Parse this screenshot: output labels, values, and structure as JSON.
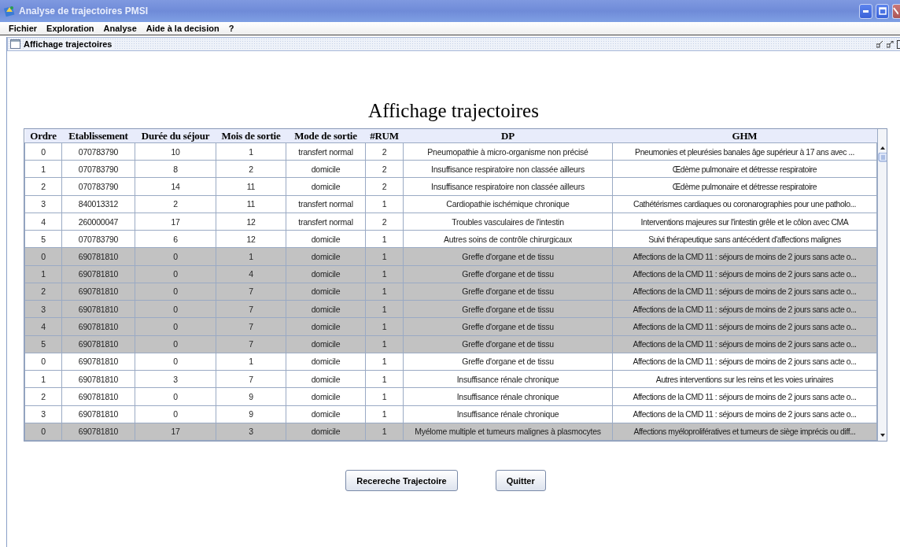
{
  "window": {
    "title": "Analyse de trajectoires PMSI"
  },
  "menu": [
    "Fichier",
    "Exploration",
    "Analyse",
    "Aide à la decision",
    "?"
  ],
  "internal_frame": {
    "title": "Affichage trajectoires"
  },
  "heading": "Affichage trajectoires",
  "table": {
    "columns": [
      "Ordre",
      "Etablissement",
      "Durée du séjour",
      "Mois de sortie",
      "Mode de sortie",
      "#RUM",
      "DP",
      "GHM"
    ],
    "rows": [
      {
        "shaded": false,
        "cells": [
          "0",
          "070783790",
          "10",
          "1",
          "transfert normal",
          "2",
          "Pneumopathie à micro-organisme non précisé",
          "Pneumonies et pleurésies banales  âge supérieur à 17 ans avec ..."
        ]
      },
      {
        "shaded": false,
        "cells": [
          "1",
          "070783790",
          "8",
          "2",
          "domicile",
          "2",
          "Insuffisance respiratoire  non classée ailleurs",
          "Œdème pulmonaire et détresse respiratoire"
        ]
      },
      {
        "shaded": false,
        "cells": [
          "2",
          "070783790",
          "14",
          "11",
          "domicile",
          "2",
          "Insuffisance respiratoire  non classée ailleurs",
          "Œdème pulmonaire et détresse respiratoire"
        ]
      },
      {
        "shaded": false,
        "cells": [
          "3",
          "840013312",
          "2",
          "11",
          "transfert normal",
          "1",
          "Cardiopathie ischémique chronique",
          "Cathétérismes cardiaques ou coronarographies pour une patholo..."
        ]
      },
      {
        "shaded": false,
        "cells": [
          "4",
          "260000047",
          "17",
          "12",
          "transfert normal",
          "2",
          "Troubles vasculaires de l'intestin",
          "Interventions majeures sur l'intestin grêle et le côlon avec CMA"
        ]
      },
      {
        "shaded": false,
        "cells": [
          "5",
          "070783790",
          "6",
          "12",
          "domicile",
          "1",
          "Autres soins de contrôle chirurgicaux",
          "Suivi thérapeutique sans antécédent d'affections malignes"
        ]
      },
      {
        "shaded": true,
        "cells": [
          "0",
          "690781810",
          "0",
          "1",
          "domicile",
          "1",
          "Greffe d'organe et de tissu",
          "Affections de la CMD 11 : séjours de moins de 2 jours  sans acte o..."
        ]
      },
      {
        "shaded": true,
        "cells": [
          "1",
          "690781810",
          "0",
          "4",
          "domicile",
          "1",
          "Greffe d'organe et de tissu",
          "Affections de la CMD 11 : séjours de moins de 2 jours  sans acte o..."
        ]
      },
      {
        "shaded": true,
        "cells": [
          "2",
          "690781810",
          "0",
          "7",
          "domicile",
          "1",
          "Greffe d'organe et de tissu",
          "Affections de la CMD 11 : séjours de moins de 2 jours  sans acte o..."
        ]
      },
      {
        "shaded": true,
        "cells": [
          "3",
          "690781810",
          "0",
          "7",
          "domicile",
          "1",
          "Greffe d'organe et de tissu",
          "Affections de la CMD 11 : séjours de moins de 2 jours  sans acte o..."
        ]
      },
      {
        "shaded": true,
        "cells": [
          "4",
          "690781810",
          "0",
          "7",
          "domicile",
          "1",
          "Greffe d'organe et de tissu",
          "Affections de la CMD 11 : séjours de moins de 2 jours  sans acte o..."
        ]
      },
      {
        "shaded": true,
        "cells": [
          "5",
          "690781810",
          "0",
          "7",
          "domicile",
          "1",
          "Greffe d'organe et de tissu",
          "Affections de la CMD 11 : séjours de moins de 2 jours  sans acte o..."
        ]
      },
      {
        "shaded": false,
        "cells": [
          "0",
          "690781810",
          "0",
          "1",
          "domicile",
          "1",
          "Greffe d'organe et de tissu",
          "Affections de la CMD 11 : séjours de moins de 2 jours  sans acte o..."
        ]
      },
      {
        "shaded": false,
        "cells": [
          "1",
          "690781810",
          "3",
          "7",
          "domicile",
          "1",
          "Insuffisance rénale chronique",
          "Autres interventions sur les reins et les voies urinaires"
        ]
      },
      {
        "shaded": false,
        "cells": [
          "2",
          "690781810",
          "0",
          "9",
          "domicile",
          "1",
          "Insuffisance rénale chronique",
          "Affections de la CMD 11 : séjours de moins de 2 jours  sans acte o..."
        ]
      },
      {
        "shaded": false,
        "cells": [
          "3",
          "690781810",
          "0",
          "9",
          "domicile",
          "1",
          "Insuffisance rénale chronique",
          "Affections de la CMD 11 : séjours de moins de 2 jours  sans acte o..."
        ]
      },
      {
        "shaded": true,
        "cells": [
          "0",
          "690781810",
          "17",
          "3",
          "domicile",
          "1",
          "Myélome multiple et tumeurs malignes à plasmocytes",
          "Affections myéloprolifératives et tumeurs de siège imprécis ou diff..."
        ]
      }
    ]
  },
  "buttons": [
    "Recereche Trajectoire",
    "Quitter"
  ]
}
